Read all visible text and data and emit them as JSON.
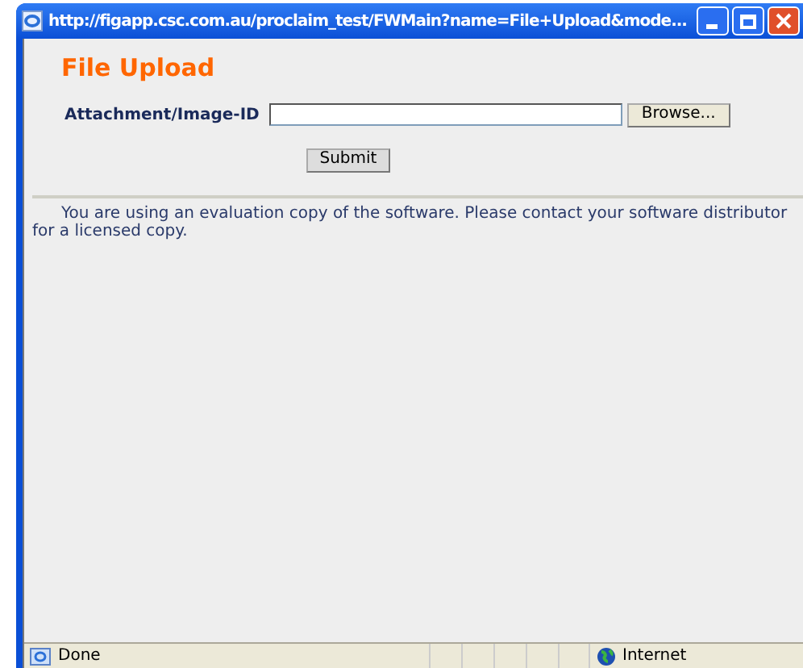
{
  "window": {
    "title": "http://figapp.csc.com.au/proclaim_test/FWMain?name=File+Upload&mode..."
  },
  "page": {
    "heading": "File Upload",
    "field": {
      "label": "Attachment/Image-ID",
      "browse": "Browse..."
    },
    "submit": "Submit",
    "notice": "You are using an evaluation copy of the software. Please contact your software distributor for a licensed copy."
  },
  "status_bar": {
    "status": "Done",
    "zone": "Internet"
  }
}
